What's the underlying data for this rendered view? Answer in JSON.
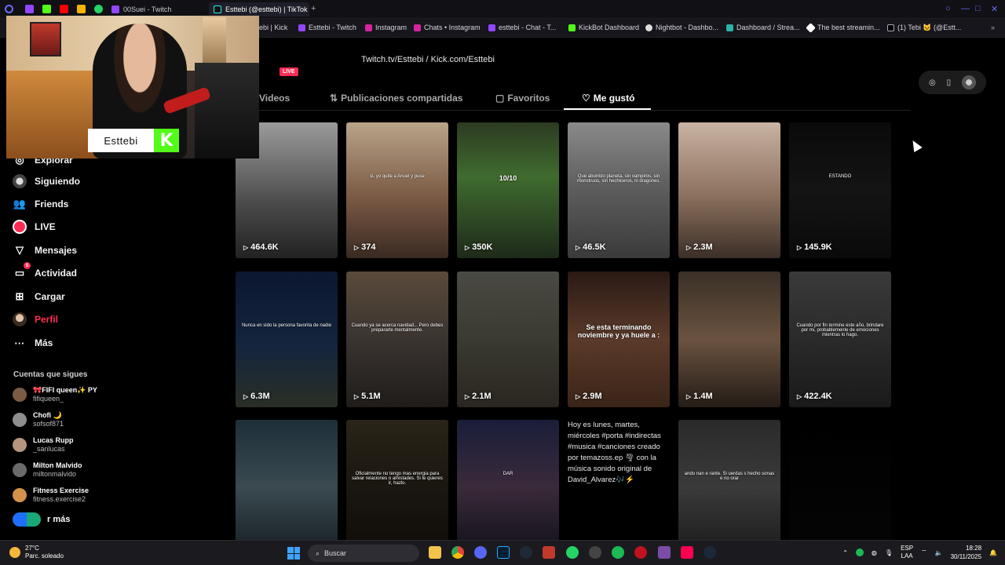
{
  "browser": {
    "tabs": [
      {
        "label": "00Suei - Twitch",
        "active": false
      },
      {
        "label": "Esttebi (@esttebi) | TikTok",
        "active": true
      }
    ],
    "new_tab": "+",
    "bookmarks": [
      "ebi | Kick",
      "Esttebi - Twitch",
      "Instagram",
      "Chats • Instagram",
      "esttebi - Chat - T...",
      "KickBot Dashboard",
      "Nightbot - Dashbo...",
      "Dashboard / Strea...",
      "The best streamin...",
      "(1) Tebi 🐱 (@Estt..."
    ]
  },
  "overlay": {
    "kick_name": "Esttebi",
    "kick_logo": "K"
  },
  "sidebar": {
    "items": [
      {
        "label": "Explorar",
        "icon": "compass-icon"
      },
      {
        "label": "Siguiendo",
        "icon": "following-icon"
      },
      {
        "label": "Friends",
        "icon": "friends-icon"
      },
      {
        "label": "LIVE",
        "icon": "live-icon"
      },
      {
        "label": "Mensajes",
        "icon": "send-icon"
      },
      {
        "label": "Actividad",
        "icon": "inbox-icon",
        "badge": "5"
      },
      {
        "label": "Cargar",
        "icon": "upload-icon"
      },
      {
        "label": "Perfil",
        "icon": "avatar"
      },
      {
        "label": "Más",
        "icon": "more-icon"
      }
    ],
    "following_heading": "Cuentas que sigues",
    "accounts": [
      {
        "name": "🎀FIFI queen✨ PY",
        "username": "fifiqueen_",
        "color": "#7a5c44"
      },
      {
        "name": "Chofi 🌙",
        "username": "sofsof871",
        "color": "#8e8e8e"
      },
      {
        "name": "Lucas Rupp",
        "username": "_sanlucas",
        "color": "#b59580"
      },
      {
        "name": "Milton Malvido",
        "username": "miltonmalvido",
        "color": "#6a6a6a"
      },
      {
        "name": "Fitness Exercise",
        "username": "fitness.exercise2",
        "color": "#d4924a"
      }
    ],
    "see_more": "r más"
  },
  "profile": {
    "bio": "Twitch.tv/Esttebi / Kick.com/Esttebi",
    "live_badge": "LIVE",
    "tabs": [
      {
        "label": "Videos",
        "icon": "grid-icon"
      },
      {
        "label": "Publicaciones compartidas",
        "icon": "repost-icon"
      },
      {
        "label": "Favoritos",
        "icon": "bookmark-icon"
      },
      {
        "label": "Me gustó",
        "icon": "heart-icon"
      }
    ],
    "active_tab": "Me gustó"
  },
  "videos": [
    {
      "views": "464.6K",
      "caption": "",
      "bg": "linear-gradient(180deg,#9b9b9b,#4a4a4a 60%,#222)"
    },
    {
      "views": "374",
      "caption": "si, yo quite a Anuel y puse",
      "bg": "linear-gradient(180deg,#b9a48a,#7a5a44 55%,#3a2a22)"
    },
    {
      "views": "350K",
      "caption": "10/10",
      "caption_big": true,
      "bg": "linear-gradient(180deg,#2d3b22,#3f6b2e 40%,#1e2a1a)"
    },
    {
      "views": "46.5K",
      "caption": "Que aburrido planeta, sin vampiros, sin monstruos, sin hechiceros, ni dragones.",
      "bg": "linear-gradient(180deg,#8a8a8a,#5c5c5c 50%,#3a3a3a)"
    },
    {
      "views": "2.3M",
      "caption": "",
      "bg": "linear-gradient(180deg,#c9b3a2,#8a6f5c 55%,#3b2f28)"
    },
    {
      "views": "145.9K",
      "caption": "ESTANDO",
      "bg": "linear-gradient(180deg,#0a0a0a,#141414 50%,#0a0a0a)"
    },
    {
      "views": "6.3M",
      "caption": "Nunca en sido la persona favorita de nadie",
      "bg": "linear-gradient(180deg,#0c1730,#14253d 55%,#2a2f25)"
    },
    {
      "views": "5.1M",
      "caption": "Cuando ya se acerca navidad... Pero debes prepararte mentalmente.",
      "bg": "linear-gradient(180deg,#5a4a3a,#3a3430 50%,#1f1c1a)"
    },
    {
      "views": "2.1M",
      "caption": "",
      "bg": "linear-gradient(180deg,#4a4a44,#3a3a30 50%,#2a2620)"
    },
    {
      "views": "2.9M",
      "caption": "Se esta terminando noviembre y ya huele a :",
      "caption_big": true,
      "bg": "linear-gradient(180deg,#2a1a14,#5a3a2a 50%,#3a2418)"
    },
    {
      "views": "1.4M",
      "caption": "",
      "bg": "linear-gradient(180deg,#3a3026,#6a5240 50%,#241c16)"
    },
    {
      "views": "422.4K",
      "caption": "Cuando por fin termine este año, brindare por mi, probablemente de emociones mientras lo hago.",
      "bg": "linear-gradient(180deg,#3a3a3a,#2a2a2a 50%,#1a1a1a)"
    },
    {
      "views": "",
      "caption": "",
      "bg": "linear-gradient(180deg,#1f2f3a,#3a4a50 50%,#151d22)"
    },
    {
      "views": "",
      "caption": "Oficialmente no tengo mas energia para salvar relaciones o amistades. Si te quieres ir, hazlo.",
      "bg": "linear-gradient(180deg,#2a2418,#1a1610 50%,#0f0c08)"
    },
    {
      "views": "",
      "caption": "DAR",
      "bg": "linear-gradient(180deg,#1a1e3a,#3a2a3a 50%,#101018)"
    },
    {
      "views": "",
      "caption": "",
      "alt_text": "Hoy es lunes, martes, miércoles #porta #indirectas #musica #canciones creado por temazoss.ep 🌪 con la música sonido original de David_Alvarez🎶⚡",
      "bg": "#000"
    },
    {
      "views": "",
      "caption": "ando nan e rante. Si uerdas s hecho sonas e no orar",
      "bg": "linear-gradient(180deg,#2a2a2a,#3a3a3a 50%,#1a1a1a)"
    },
    {
      "views": "",
      "caption": "",
      "bg": "linear-gradient(180deg,#000,#050505)"
    }
  ],
  "taskbar": {
    "weather_temp": "27°C",
    "weather_desc": "Parc. soleado",
    "search_placeholder": "Buscar",
    "lang_top": "ESP",
    "lang_bottom": "LAA",
    "time": "18:28",
    "date": "30/11/2025"
  },
  "colors": {
    "accent": "#fe2c55",
    "kick": "#53fc18",
    "twitch": "#9146ff"
  }
}
